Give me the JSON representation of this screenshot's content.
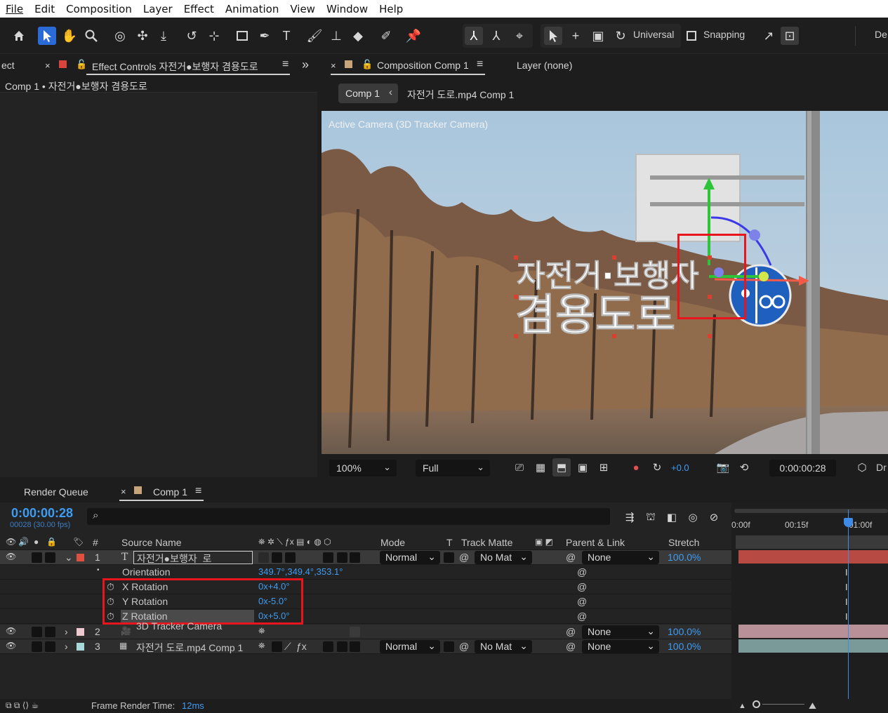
{
  "menu": [
    "File",
    "Edit",
    "Composition",
    "Layer",
    "Effect",
    "Animation",
    "View",
    "Window",
    "Help"
  ],
  "toolbar": {
    "universal_label": "Universal",
    "snapping_label": "Snapping",
    "workspace_label": "De"
  },
  "effect_controls": {
    "left_tab_partial": "ect",
    "tab_label": "Effect Controls 자전거●보행자 겸용도로",
    "breadcrumb": "Comp 1 • 자전거●보행자 겸용도로",
    "swatch_color": "#d9453c"
  },
  "composition": {
    "tab_label": "Composition Comp 1",
    "layer_tab_label": "Layer (none)",
    "breadcrumb_comp": "Comp 1",
    "breadcrumb_next": "자전거 도로.mp4 Comp 1",
    "camera_label": "Active Camera (3D Tracker Camera)",
    "overlay_line1": "자전거·보행자",
    "overlay_line2": "겸용도로",
    "zoom": "100%",
    "resolution": "Full",
    "exposure": "+0.0",
    "timecode": "0:00:00:28",
    "right_partial": "Dr",
    "swatch_color": "#c8a47a"
  },
  "timeline": {
    "render_queue_tab": "Render Queue",
    "comp_tab": "Comp 1",
    "timecode": "0:00:00:28",
    "frames": "00028 (30.00 fps)",
    "search_placeholder": "",
    "ruler": [
      "0:00f",
      "00:15f",
      "01:00f"
    ],
    "columns": {
      "num": "#",
      "source_name": "Source Name",
      "mode": "Mode",
      "t": "T",
      "track_matte": "Track Matte",
      "parent_link": "Parent & Link",
      "stretch": "Stretch"
    },
    "layers": [
      {
        "num": "1",
        "name": "자전거●보행자_로",
        "mode": "Normal",
        "matte": "No Mat",
        "parent": "None",
        "stretch": "100.0%",
        "label_color": "#e05040"
      },
      {
        "num": "2",
        "name": "3D Tracker Camera",
        "mode": "",
        "matte": "",
        "parent": "None",
        "stretch": "100.0%",
        "label_color": "#f0c8d0"
      },
      {
        "num": "3",
        "name": "자전거 도로.mp4 Comp 1",
        "mode": "Normal",
        "matte": "No Mat",
        "parent": "None",
        "stretch": "100.0%",
        "label_color": "#a8d8d8"
      }
    ],
    "properties": [
      {
        "name": "Orientation",
        "value": "349.7°,349.4°,353.1°"
      },
      {
        "name": "X Rotation",
        "value": "0x+4.0°"
      },
      {
        "name": "Y Rotation",
        "value": "0x-5.0°"
      },
      {
        "name": "Z Rotation",
        "value": "0x+5.0°"
      }
    ],
    "footer_label": "Frame Render Time:",
    "footer_value": "12ms"
  }
}
